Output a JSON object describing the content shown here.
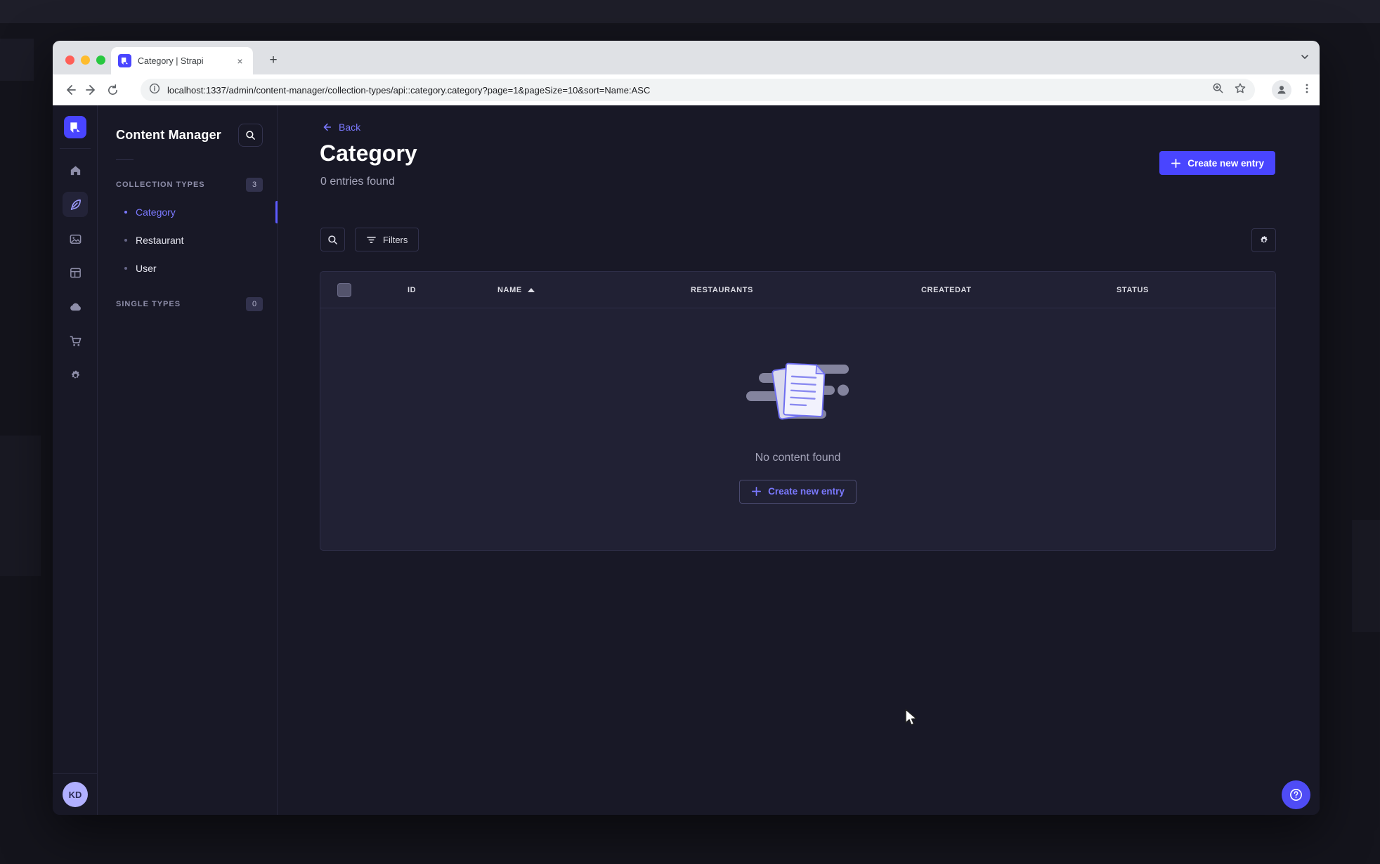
{
  "browser": {
    "tab_title": "Category | Strapi",
    "url": "localhost:1337/admin/content-manager/collection-types/api::category.category?page=1&pageSize=10&sort=Name:ASC",
    "close_glyph": "×",
    "new_tab_glyph": "+"
  },
  "rail": {
    "user_initials": "KD",
    "icons": [
      "strapi-logo",
      "home",
      "content-manager-feather",
      "media-library",
      "content-type-builder",
      "cloud",
      "marketplace-cart",
      "settings-gear"
    ]
  },
  "content_manager": {
    "title": "Content Manager",
    "collection_types": {
      "label": "COLLECTION TYPES",
      "count": "3",
      "items": [
        {
          "label": "Category",
          "active": true
        },
        {
          "label": "Restaurant",
          "active": false
        },
        {
          "label": "User",
          "active": false
        }
      ]
    },
    "single_types": {
      "label": "SINGLE TYPES",
      "count": "0"
    }
  },
  "main": {
    "back_label": "Back",
    "title": "Category",
    "subtitle": "0 entries found",
    "create_button_label": "Create new entry",
    "filters_button_label": "Filters",
    "table": {
      "columns": [
        "ID",
        "NAME",
        "RESTAURANTS",
        "CREATEDAT",
        "STATUS"
      ],
      "sorted_column": "NAME",
      "sort_direction": "ASC",
      "rows": []
    },
    "empty_state": {
      "message": "No content found",
      "cta_label": "Create new entry"
    }
  },
  "colors": {
    "primary": "#4945ff",
    "primary_text": "#7b79ff",
    "page_bg": "#181826",
    "card_bg": "#212134",
    "border": "#32324d",
    "text_secondary": "#a5a5ba"
  }
}
